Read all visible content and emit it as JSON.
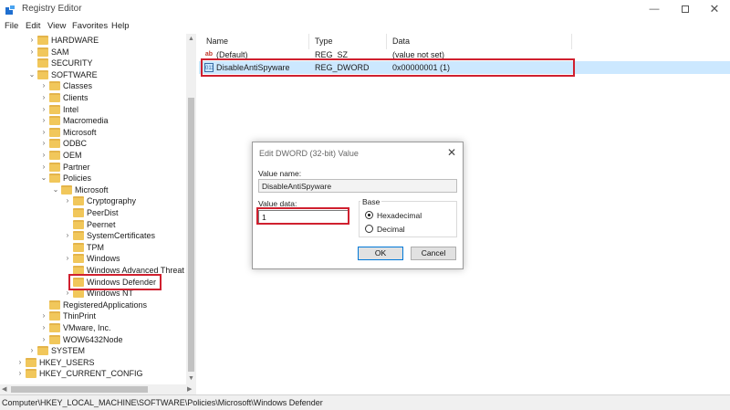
{
  "window": {
    "title": "Registry Editor",
    "minimize_glyph": "—",
    "close_glyph": "✕"
  },
  "menu": [
    "File",
    "Edit",
    "View",
    "Favorites",
    "Help"
  ],
  "tree": {
    "items": [
      {
        "label": "HARDWARE",
        "expander": ">"
      },
      {
        "label": "SAM",
        "expander": ">"
      },
      {
        "label": "SECURITY",
        "expander": ""
      },
      {
        "label": "SOFTWARE",
        "expander": "v"
      },
      {
        "label": "Classes",
        "expander": ">"
      },
      {
        "label": "Clients",
        "expander": ">"
      },
      {
        "label": "Intel",
        "expander": ">"
      },
      {
        "label": "Macromedia",
        "expander": ">"
      },
      {
        "label": "Microsoft",
        "expander": ">"
      },
      {
        "label": "ODBC",
        "expander": ">"
      },
      {
        "label": "OEM",
        "expander": ">"
      },
      {
        "label": "Partner",
        "expander": ">"
      },
      {
        "label": "Policies",
        "expander": "v"
      },
      {
        "label": "Microsoft",
        "expander": "v"
      },
      {
        "label": "Cryptography",
        "expander": ">"
      },
      {
        "label": "PeerDist",
        "expander": ""
      },
      {
        "label": "Peernet",
        "expander": ""
      },
      {
        "label": "SystemCertificates",
        "expander": ">"
      },
      {
        "label": "TPM",
        "expander": ""
      },
      {
        "label": "Windows",
        "expander": ">"
      },
      {
        "label": "Windows Advanced Threat P",
        "expander": ""
      },
      {
        "label": "Windows Defender",
        "expander": ""
      },
      {
        "label": "Windows NT",
        "expander": ">"
      },
      {
        "label": "RegisteredApplications",
        "expander": ""
      },
      {
        "label": "ThinPrint",
        "expander": ">"
      },
      {
        "label": "VMware, Inc.",
        "expander": ">"
      },
      {
        "label": "WOW6432Node",
        "expander": ">"
      },
      {
        "label": "SYSTEM",
        "expander": ">"
      },
      {
        "label": "HKEY_USERS",
        "expander": ">"
      },
      {
        "label": "HKEY_CURRENT_CONFIG",
        "expander": ">"
      }
    ]
  },
  "values": {
    "headers": {
      "name": "Name",
      "type": "Type",
      "data": "Data"
    },
    "rows": [
      {
        "name": "(Default)",
        "type": "REG_SZ",
        "data": "(value not set)",
        "icon": "ab"
      },
      {
        "name": "DisableAntiSpyware",
        "type": "REG_DWORD",
        "data": "0x00000001 (1)",
        "icon": "011"
      }
    ]
  },
  "dialog": {
    "title": "Edit DWORD (32-bit) Value",
    "close_glyph": "✕",
    "value_name_label": "Value name:",
    "value_name": "DisableAntiSpyware",
    "value_data_label": "Value data:",
    "value_data": "1",
    "base_label": "Base",
    "base_options": [
      "Hexadecimal",
      "Decimal"
    ],
    "base_selected": "Hexadecimal",
    "ok_label": "OK",
    "cancel_label": "Cancel"
  },
  "statusbar": {
    "path": "Computer\\HKEY_LOCAL_MACHINE\\SOFTWARE\\Policies\\Microsoft\\Windows Defender"
  },
  "colors": {
    "highlight": "#d0202f",
    "selection": "#cce8ff",
    "folder": "#f1c75b"
  }
}
